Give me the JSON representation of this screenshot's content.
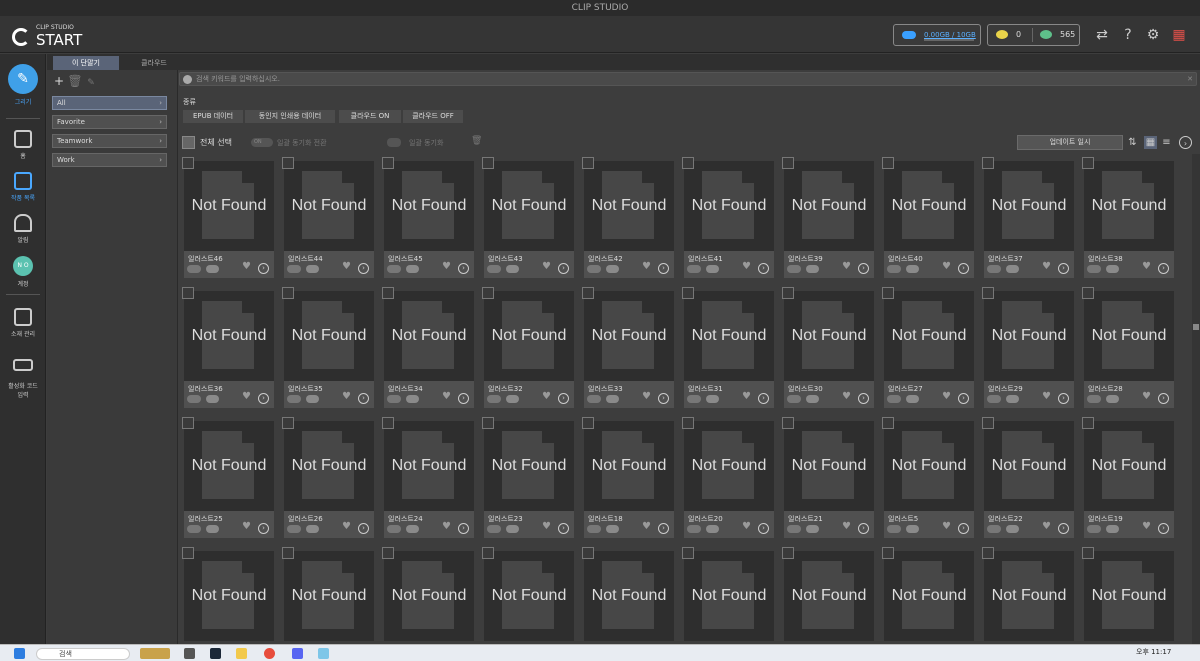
{
  "window": {
    "title": "CLIP STUDIO"
  },
  "header": {
    "logo_line1": "CLIP STUDIO",
    "logo_line2": "START",
    "storage_text": "0.00GB / 10GB",
    "gold_count": "0",
    "clippy_count": "565",
    "accent_color": "#3aa0ff"
  },
  "nav": {
    "draw": "그리기",
    "home": "홈",
    "works": "작품 목록",
    "notifications": "알림",
    "account_badge": "N O",
    "account": "계정",
    "assets": "소재 관리",
    "activation": "활성화 코드\n입력"
  },
  "tabs": {
    "device": "이 단말기",
    "cloud": "클라우드"
  },
  "folders": [
    {
      "label": "All",
      "active": true
    },
    {
      "label": "Favorite"
    },
    {
      "label": "Teamwork"
    },
    {
      "label": "Work"
    }
  ],
  "search": {
    "placeholder": "검색 키워드를 입력하십시오."
  },
  "filter": {
    "heading": "종류",
    "chips": [
      "EPUB 데이터",
      "동인지 인쇄용 데이터",
      "클라우드 ON",
      "클라우드 OFF"
    ]
  },
  "toolbar": {
    "select_all": "전체 선택",
    "toggle_text": "ON",
    "bulk_sync_switch": "일괄 동기화 전환",
    "bulk_sync": "일괄 동기화",
    "sort_label": "업데이트 일시"
  },
  "cards": {
    "not_found_text": "Not Found",
    "names": [
      "일러스트46",
      "일러스트44",
      "일러스트45",
      "일러스트43",
      "일러스트42",
      "일러스트41",
      "일러스트39",
      "일러스트40",
      "일러스트37",
      "일러스트38",
      "일러스트36",
      "일러스트35",
      "일러스트34",
      "일러스트32",
      "일러스트33",
      "일러스트31",
      "일러스트30",
      "일러스트27",
      "일러스트29",
      "일러스트28",
      "일러스트25",
      "일러스트26",
      "일러스트24",
      "일러스트23",
      "일러스트18",
      "일러스트20",
      "일러스트21",
      "일러스트5",
      "일러스트22",
      "일러스트19",
      "",
      "",
      "",
      "",
      "",
      "",
      "",
      "",
      "",
      ""
    ]
  },
  "taskbar": {
    "search_text": "검색",
    "time": "오후 11:17"
  }
}
